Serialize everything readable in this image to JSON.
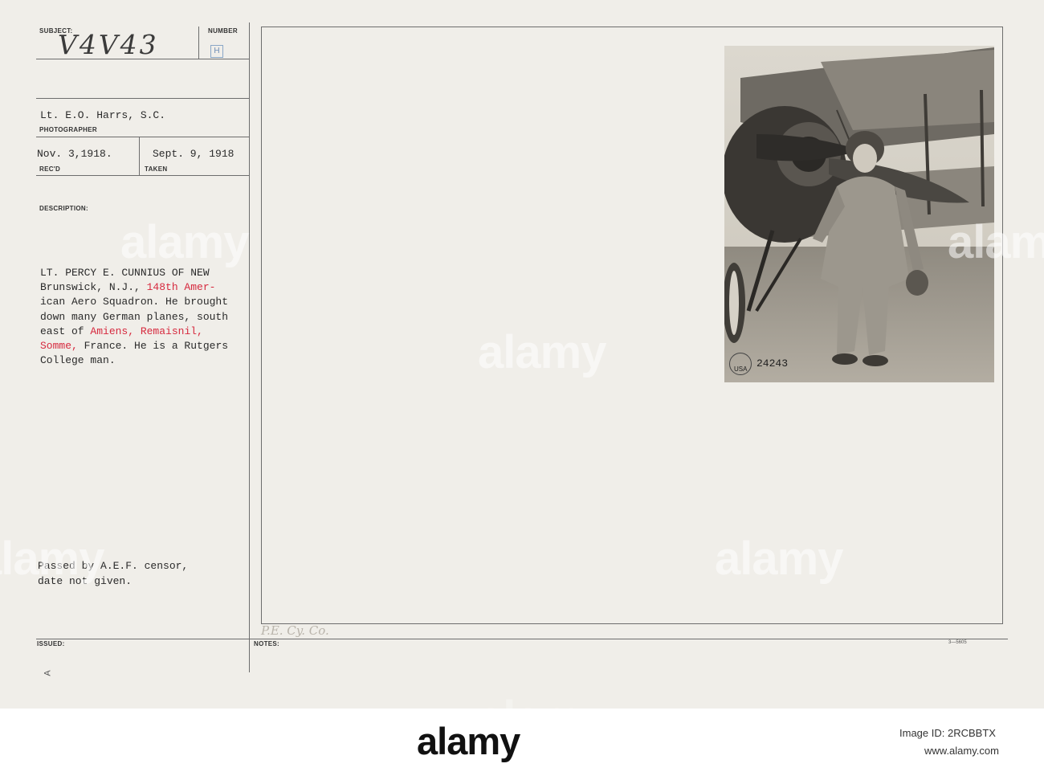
{
  "header": {
    "subject_label": "SUBJECT:",
    "subject_value": "V4V43",
    "number_label": "NUMBER",
    "number_value": "H",
    "photographer_name": "Lt. E.O. Harrs, S.C.",
    "photographer_label": "PHOTOGRAPHER",
    "received_date": "Nov. 3,1918.",
    "received_label": "REC'D",
    "taken_date": "Sept. 9, 1918",
    "taken_label": "TAKEN"
  },
  "description": {
    "label": "DESCRIPTION:",
    "lines": [
      [
        {
          "t": "LT. PERCY E. CUNNIUS OF NEW",
          "red": false
        }
      ],
      [
        {
          "t": "Brunswick, N.J., ",
          "red": false
        },
        {
          "t": "148th Amer-",
          "red": true
        }
      ],
      [
        {
          "t": "ican Aero Squadron. He brought",
          "red": false
        }
      ],
      [
        {
          "t": "down many German planes, south",
          "red": false
        }
      ],
      [
        {
          "t": "east of ",
          "red": false
        },
        {
          "t": "Amiens, Remaisnil,",
          "red": true
        }
      ],
      [
        {
          "t": "Somme,",
          "red": true
        },
        {
          "t": " France. He is a Rutgers",
          "red": false
        }
      ],
      [
        {
          "t": "College man.",
          "red": false
        }
      ]
    ]
  },
  "censor": {
    "line1": "Passed by A.E.F. censor,",
    "line2": "date not given."
  },
  "footer_fields": {
    "issued_label": "ISSUED:",
    "notes_label": "NOTES:",
    "notes_handwriting": "P.E. Cy. Co.",
    "form_number": "3—5605",
    "marker": "A"
  },
  "photo": {
    "stamp_number": "24243",
    "stamp_text": "USA",
    "alt": "Aviator in flight suit standing beside biplane propeller"
  },
  "watermarks": [
    "alamy",
    "alamy",
    "alamy",
    "alamy",
    "alamy",
    "alamy"
  ],
  "footer_bar": {
    "logo": "alamy",
    "image_id_label": "Image ID: 2RCBBTX",
    "site": "www.alamy.com"
  }
}
